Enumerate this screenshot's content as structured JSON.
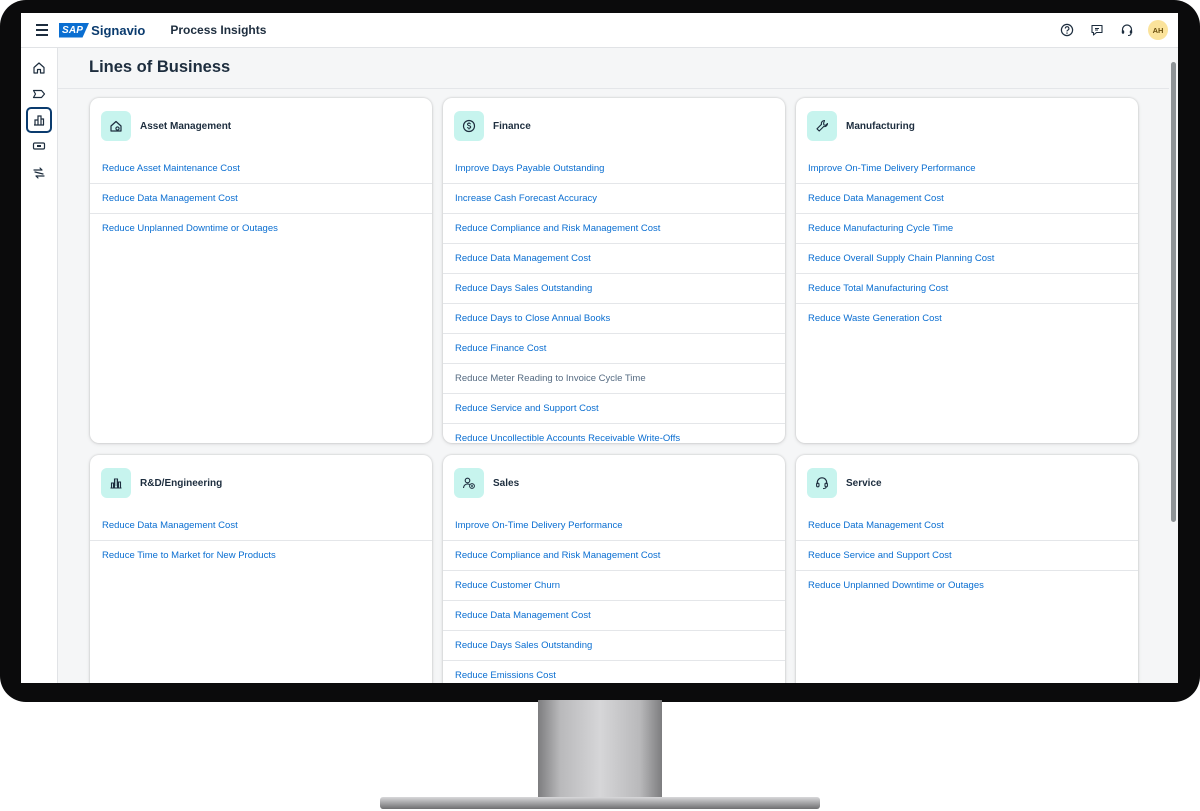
{
  "shellbar": {
    "brand_mark": "SAP",
    "brand_name": "Signavio",
    "app_title": "Process Insights",
    "user_initials": "AH"
  },
  "page": {
    "title": "Lines of Business"
  },
  "sidenav": {
    "items": [
      {
        "icon": "home-icon",
        "active": false
      },
      {
        "icon": "tag-icon",
        "active": false
      },
      {
        "icon": "building-icon",
        "active": true
      },
      {
        "icon": "ticket-icon",
        "active": false
      },
      {
        "icon": "transfer-icon",
        "active": false
      }
    ]
  },
  "colors": {
    "accent": "#0a6ed1",
    "icon_bg": "#c7f4ee",
    "title": "#1d2d3e",
    "avatar_bg": "#fbe39b"
  },
  "cards": [
    {
      "title": "Asset Management",
      "icon": "house-wrench-icon",
      "links": [
        "Reduce Asset Maintenance Cost",
        "Reduce Data Management Cost",
        "Reduce Unplanned Downtime or Outages"
      ]
    },
    {
      "title": "Finance",
      "icon": "coin-icon",
      "links": [
        "Improve Days Payable Outstanding",
        "Increase Cash Forecast Accuracy",
        "Reduce Compliance and Risk Management Cost",
        "Reduce Data Management Cost",
        "Reduce Days Sales Outstanding",
        "Reduce Days to Close Annual Books",
        "Reduce Finance Cost",
        "Reduce Meter Reading to Invoice Cycle Time",
        "Reduce Service and Support Cost",
        "Reduce Uncollectible Accounts Receivable Write-Offs"
      ]
    },
    {
      "title": "Manufacturing",
      "icon": "wrench-icon",
      "links": [
        "Improve On-Time Delivery Performance",
        "Reduce Data Management Cost",
        "Reduce Manufacturing Cycle Time",
        "Reduce Overall Supply Chain Planning Cost",
        "Reduce Total Manufacturing Cost",
        "Reduce Waste Generation Cost"
      ]
    },
    {
      "title": "R&D/Engineering",
      "icon": "factory-icon",
      "links": [
        "Reduce Data Management Cost",
        "Reduce Time to Market for New Products"
      ]
    },
    {
      "title": "Sales",
      "icon": "sales-person-icon",
      "links": [
        "Improve On-Time Delivery Performance",
        "Reduce Compliance and Risk Management Cost",
        "Reduce Customer Churn",
        "Reduce Data Management Cost",
        "Reduce Days Sales Outstanding",
        "Reduce Emissions Cost"
      ]
    },
    {
      "title": "Service",
      "icon": "headset-icon",
      "links": [
        "Reduce Data Management Cost",
        "Reduce Service and Support Cost",
        "Reduce Unplanned Downtime or Outages"
      ]
    }
  ]
}
